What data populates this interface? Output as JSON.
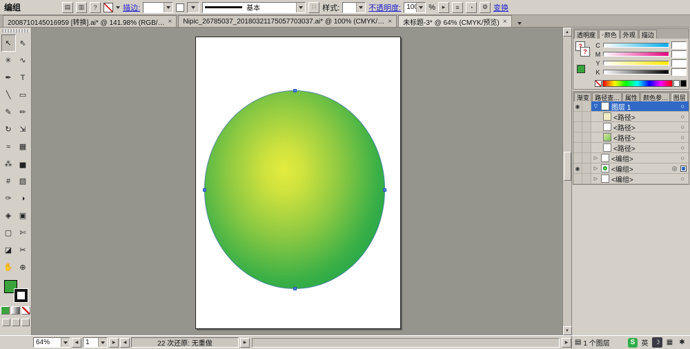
{
  "control_bar": {
    "title": "编组",
    "stroke_link": "描边:",
    "brush_value": "基本",
    "style_label": "样式:",
    "opacity_link": "不透明度:",
    "opacity_value": "100",
    "opacity_unit": "%",
    "transform_link": "变换"
  },
  "icons": {
    "doc": "▤",
    "doc2": "▥",
    "help": "?",
    "dots": "∷",
    "menu_lines": "≡",
    "circle": "◔",
    "gear": "⚙",
    "flyout": "▸",
    "dot": "◦",
    "eye": "◉",
    "target": "○",
    "target_selected": "◎",
    "expand_open": "▽",
    "expand_closed": "▷",
    "up_arrow": "▲",
    "down_arrow": "▼",
    "left_arrow": "◀",
    "right_arrow": "▶"
  },
  "tab_bar": {
    "tabs": [
      {
        "label": "2008710145016959 [转换].ai* @ 141.98% (RGB/…",
        "close": "×"
      },
      {
        "label": "Nipic_26785037_20180321175057703037.ai* @ 100% (CMYK/…",
        "close": "×"
      },
      {
        "label": "未标题-3* @ 64% (CMYK/预览)",
        "close": "×"
      }
    ]
  },
  "tools": [
    {
      "name": "selection-tool",
      "glyph": "↖"
    },
    {
      "name": "direct-selection-tool",
      "glyph": "⇖"
    },
    {
      "name": "magic-wand-tool",
      "glyph": "✳"
    },
    {
      "name": "lasso-tool",
      "glyph": "∿"
    },
    {
      "name": "pen-tool",
      "glyph": "✒"
    },
    {
      "name": "type-tool",
      "glyph": "T"
    },
    {
      "name": "line-segment-tool",
      "glyph": "╲"
    },
    {
      "name": "rectangle-tool",
      "glyph": "▭"
    },
    {
      "name": "paintbrush-tool",
      "glyph": "✎"
    },
    {
      "name": "pencil-tool",
      "glyph": "✏"
    },
    {
      "name": "rotate-tool",
      "glyph": "↻"
    },
    {
      "name": "scale-tool",
      "glyph": "⇲"
    },
    {
      "name": "warp-tool",
      "glyph": "≈"
    },
    {
      "name": "free-transform-tool",
      "glyph": "▦"
    },
    {
      "name": "symbol-sprayer-tool",
      "glyph": "⁂"
    },
    {
      "name": "column-graph-tool",
      "glyph": "▅"
    },
    {
      "name": "mesh-tool",
      "glyph": "#"
    },
    {
      "name": "gradient-tool",
      "glyph": "▧"
    },
    {
      "name": "eyedropper-tool",
      "glyph": "✑"
    },
    {
      "name": "blend-tool",
      "glyph": "◑"
    },
    {
      "name": "live-paint-bucket-tool",
      "glyph": "◈"
    },
    {
      "name": "live-paint-selection-tool",
      "glyph": "▣"
    },
    {
      "name": "crop-area-tool",
      "glyph": "▢"
    },
    {
      "name": "slice-tool",
      "glyph": "✄"
    },
    {
      "name": "eraser-tool",
      "glyph": "◪"
    },
    {
      "name": "scissors-tool",
      "glyph": "✂"
    },
    {
      "name": "hand-tool",
      "glyph": "✋"
    },
    {
      "name": "zoom-tool",
      "glyph": "⊕"
    }
  ],
  "color_panel": {
    "tabs": [
      "透明度",
      "颜色",
      "外观",
      "描边"
    ],
    "unknown_mark": "?",
    "channels": [
      {
        "label": "C",
        "value": ""
      },
      {
        "label": "M",
        "value": ""
      },
      {
        "label": "Y",
        "value": ""
      },
      {
        "label": "K",
        "value": ""
      }
    ]
  },
  "layers_panel": {
    "tabs": [
      "渐变",
      "路径查…",
      "属性",
      "颜色参…",
      "图层"
    ],
    "rows": [
      {
        "label": "图层 1"
      },
      {
        "label": "<路径>"
      },
      {
        "label": "<路径>"
      },
      {
        "label": "<路径>"
      },
      {
        "label": "<路径>"
      },
      {
        "label": "<编组>"
      },
      {
        "label": "<编组>"
      },
      {
        "label": "<编组>"
      }
    ]
  },
  "status_bar": {
    "zoom_value": "64%",
    "page_value": "1",
    "undo_status": "22 次还原: 无重做",
    "layer_count": "1 个图层"
  },
  "tray": {
    "ime_logo": "S",
    "lang": "英",
    "moon": "☽",
    "keyboard": "▦",
    "toolbox": "✱"
  },
  "colors": {
    "chrome": "#d4d0c8",
    "canvas_bg": "#95958d",
    "selection_blue": "#3169c6",
    "circle_center": "#e0e93e",
    "circle_edge": "#17a04b",
    "fill_green": "#3aa33c"
  }
}
